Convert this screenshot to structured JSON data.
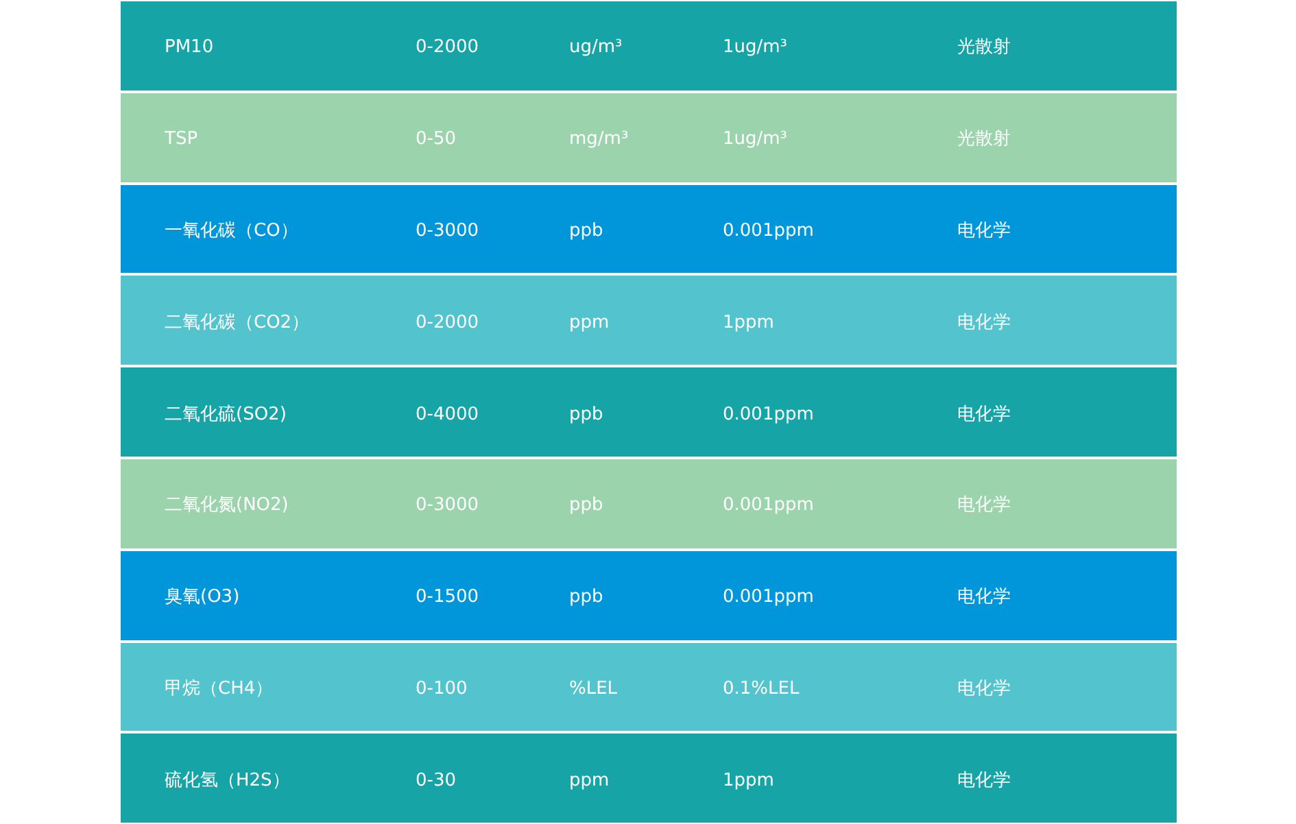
{
  "rows": [
    {
      "color": "#17a4a7",
      "cells": [
        "PM10",
        "0-2000",
        "ug/m³",
        "1ug/m³",
        "光散射"
      ]
    },
    {
      "color": "#9bd3ad",
      "cells": [
        "TSP",
        "0-50",
        "mg/m³",
        "1ug/m³",
        "光散射"
      ]
    },
    {
      "color": "#0096d9",
      "cells": [
        "一氧化碳（CO）",
        "0-3000",
        "ppb",
        "0.001ppm",
        "电化学"
      ]
    },
    {
      "color": "#53c3cd",
      "cells": [
        "二氧化碳（CO2）",
        "0-2000",
        "ppm",
        "1ppm",
        "电化学"
      ]
    },
    {
      "color": "#17a4a7",
      "cells": [
        "二氧化硫(SO2)",
        "0-4000",
        "ppb",
        "0.001ppm",
        "电化学"
      ]
    },
    {
      "color": "#9bd3ad",
      "cells": [
        "二氧化氮(NO2)",
        "0-3000",
        "ppb",
        "0.001ppm",
        "电化学"
      ]
    },
    {
      "color": "#0096d9",
      "cells": [
        "臭氧(O3)",
        "0-1500",
        "ppb",
        "0.001ppm",
        "电化学"
      ]
    },
    {
      "color": "#53c3cd",
      "cells": [
        "甲烷（CH4）",
        "0-100",
        "%LEL",
        "0.1%LEL",
        "电化学"
      ]
    },
    {
      "color": "#17a4a7",
      "cells": [
        "硫化氢（H2S）",
        "0-30",
        "ppm",
        "1ppm",
        "电化学"
      ]
    }
  ]
}
